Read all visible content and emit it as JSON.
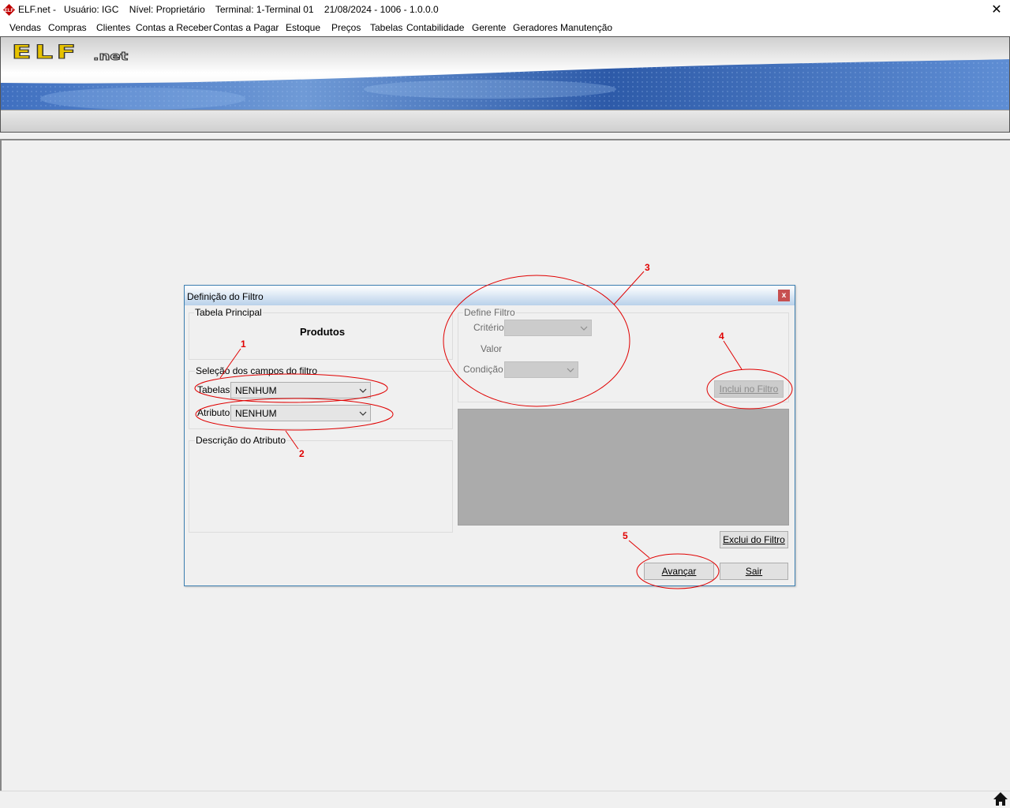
{
  "window": {
    "title": "ELF.net -   Usuário: IGC    Nível: Proprietário    Terminal: 1-Terminal 01    21/08/2024 - 1006 - 1.0.0.0",
    "close_glyph": "✕"
  },
  "menu": [
    {
      "label": "Vendas"
    },
    {
      "label": "Compras"
    },
    {
      "label": "Clientes"
    },
    {
      "label": "Contas a Receber"
    },
    {
      "label": "Contas a Pagar"
    },
    {
      "label": "Estoque"
    },
    {
      "label": "Preços"
    },
    {
      "label": "Tabelas"
    },
    {
      "label": "Contabilidade"
    },
    {
      "label": "Gerente"
    },
    {
      "label": "Geradores"
    },
    {
      "label": "Manutenção"
    }
  ],
  "banner": {
    "logo_text": "ELF",
    "logo_suffix": ".net",
    "logo_color": "#e6c200"
  },
  "dialog": {
    "title": "Definição do Filtro",
    "close_glyph": "x",
    "tabela_principal": {
      "label": "Tabela Principal",
      "value": "Produtos"
    },
    "selecao": {
      "label": "Seleção dos campos do filtro",
      "tabelas_label": "Tabelas",
      "tabelas_value": "NENHUM",
      "atributo_label": "Atributo",
      "atributo_value": "NENHUM"
    },
    "descricao": {
      "label": "Descrição do Atributo"
    },
    "define_filtro": {
      "label": "Define Filtro",
      "criterio_label": "Critério",
      "criterio_value": "",
      "valor_label": "Valor",
      "condicao_label": "Condição",
      "condicao_value": ""
    },
    "buttons": {
      "inclui": "Inclui no Filtro",
      "exclui": "Exclui do Filtro",
      "avancar": "Avançar",
      "sair": "Sair"
    }
  },
  "annotations": {
    "color": "#e00000",
    "labels": [
      "1",
      "2",
      "3",
      "4",
      "5"
    ]
  }
}
